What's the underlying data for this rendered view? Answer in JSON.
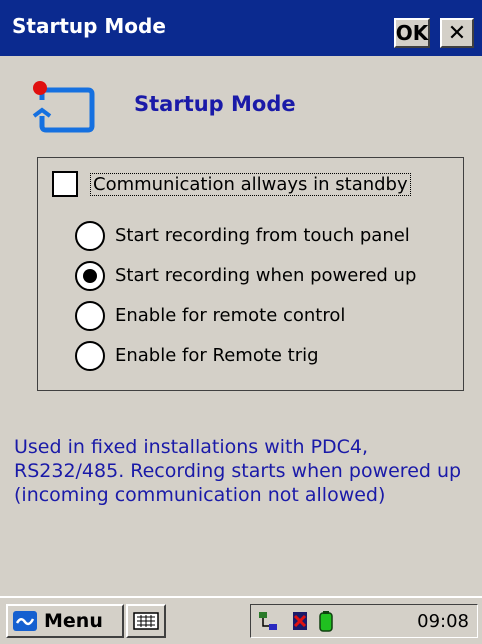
{
  "window": {
    "title": "Startup Mode",
    "ok_label": "OK",
    "close_label": "✕"
  },
  "header": {
    "title": "Startup Mode",
    "icon": "refresh-icon"
  },
  "options": {
    "checkbox": {
      "label": "Communication allways in standby",
      "checked": false
    },
    "radios": [
      {
        "label": "Start recording from touch panel",
        "selected": false
      },
      {
        "label": "Start recording when powered up",
        "selected": true
      },
      {
        "label": "Enable for remote control",
        "selected": false
      },
      {
        "label": "Enable for Remote trig",
        "selected": false
      }
    ]
  },
  "description": "Used in fixed installations with PDC4, RS232/485. Recording starts when powered up (incoming communication not allowed)",
  "taskbar": {
    "menu_label": "Menu",
    "clock": "09:08"
  },
  "colors": {
    "titlebar": "#0b2a8f",
    "accent_text": "#1a1aa8",
    "background": "#d4d0c8"
  }
}
